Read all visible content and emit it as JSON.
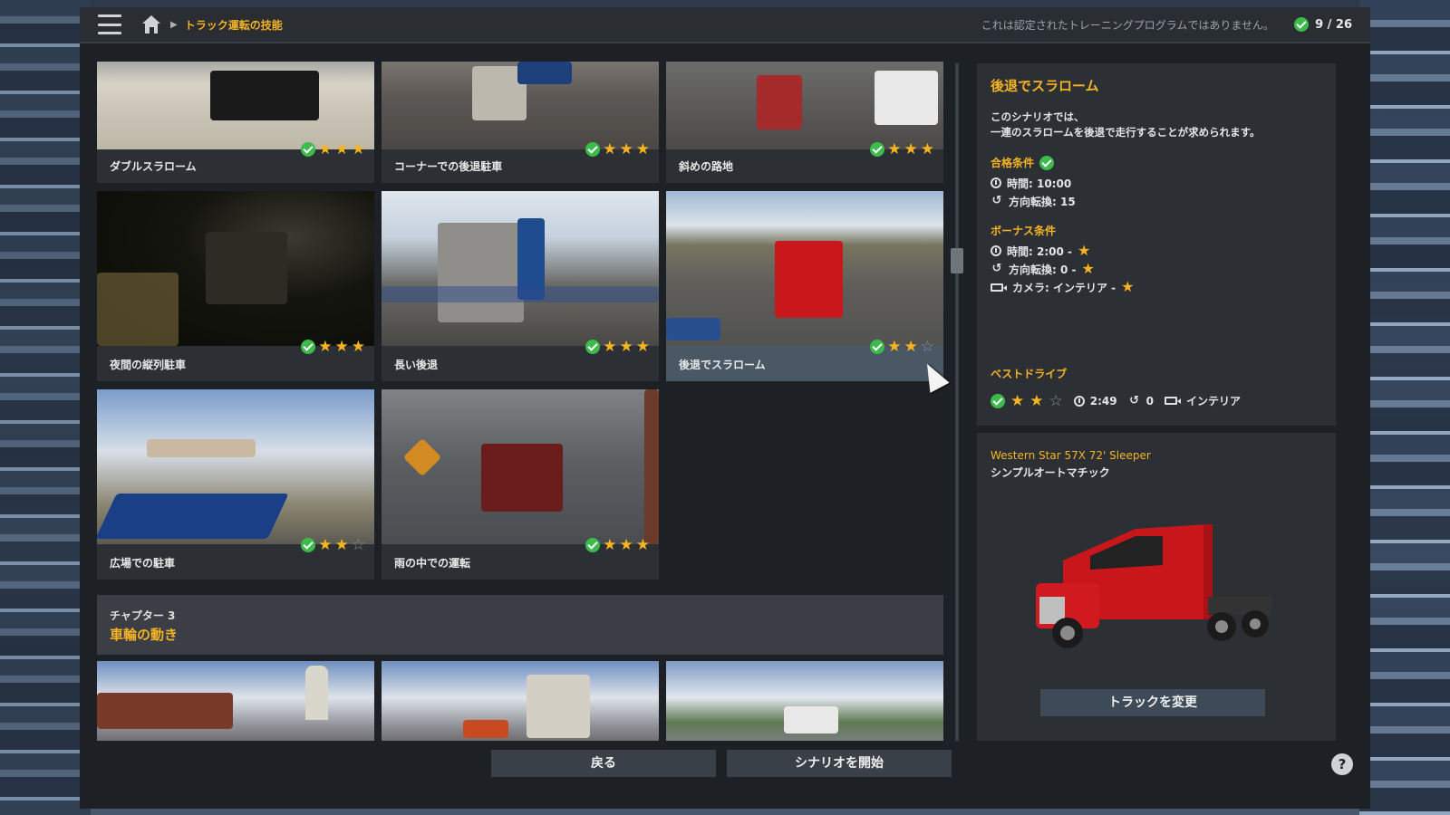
{
  "topbar": {
    "breadcrumb": "トラック運転の技能",
    "disclaimer": "これは認定されたトレーニングプログラムではありません。",
    "progress": "9 / 26"
  },
  "scenarios": [
    {
      "label": "ダブルスラローム",
      "completed": true,
      "stars": 3
    },
    {
      "label": "コーナーでの後退駐車",
      "completed": true,
      "stars": 3
    },
    {
      "label": "斜めの路地",
      "completed": true,
      "stars": 3
    },
    {
      "label": "夜間の縦列駐車",
      "completed": true,
      "stars": 3
    },
    {
      "label": "長い後退",
      "completed": true,
      "stars": 3
    },
    {
      "label": "後退でスラローム",
      "completed": true,
      "stars": 2,
      "selected": true
    },
    {
      "label": "広場での駐車",
      "completed": true,
      "stars": 2
    },
    {
      "label": "雨の中での運転",
      "completed": true,
      "stars": 3
    }
  ],
  "chapter": {
    "subtitle": "チャプター 3",
    "title": "車輪の動き"
  },
  "detail": {
    "title": "後退でスラローム",
    "description_line1": "このシナリオでは、",
    "description_line2": "一連のスラロームを後退で走行することが求められます。",
    "pass_title": "合格条件",
    "pass_time": "時間: 10:00",
    "pass_turns": "方向転換: 15",
    "bonus_title": "ボーナス条件",
    "bonus_time": "時間: 2:00 -",
    "bonus_turns": "方向転換: 0 -",
    "bonus_camera": "カメラ: インテリア -",
    "best_title": "ベストドライブ",
    "best_stars": 2,
    "best_time": "2:49",
    "best_turns": "0",
    "best_camera": "インテリア"
  },
  "truck": {
    "model": "Western Star 57X 72' Sleeper",
    "transmission": "シンプルオートマチック",
    "change_label": "トラックを変更"
  },
  "buttons": {
    "back": "戻る",
    "start": "シナリオを開始",
    "help": "?"
  },
  "colors": {
    "accent": "#f5b325",
    "check": "#3cba4c",
    "panel": "#2c3035"
  }
}
